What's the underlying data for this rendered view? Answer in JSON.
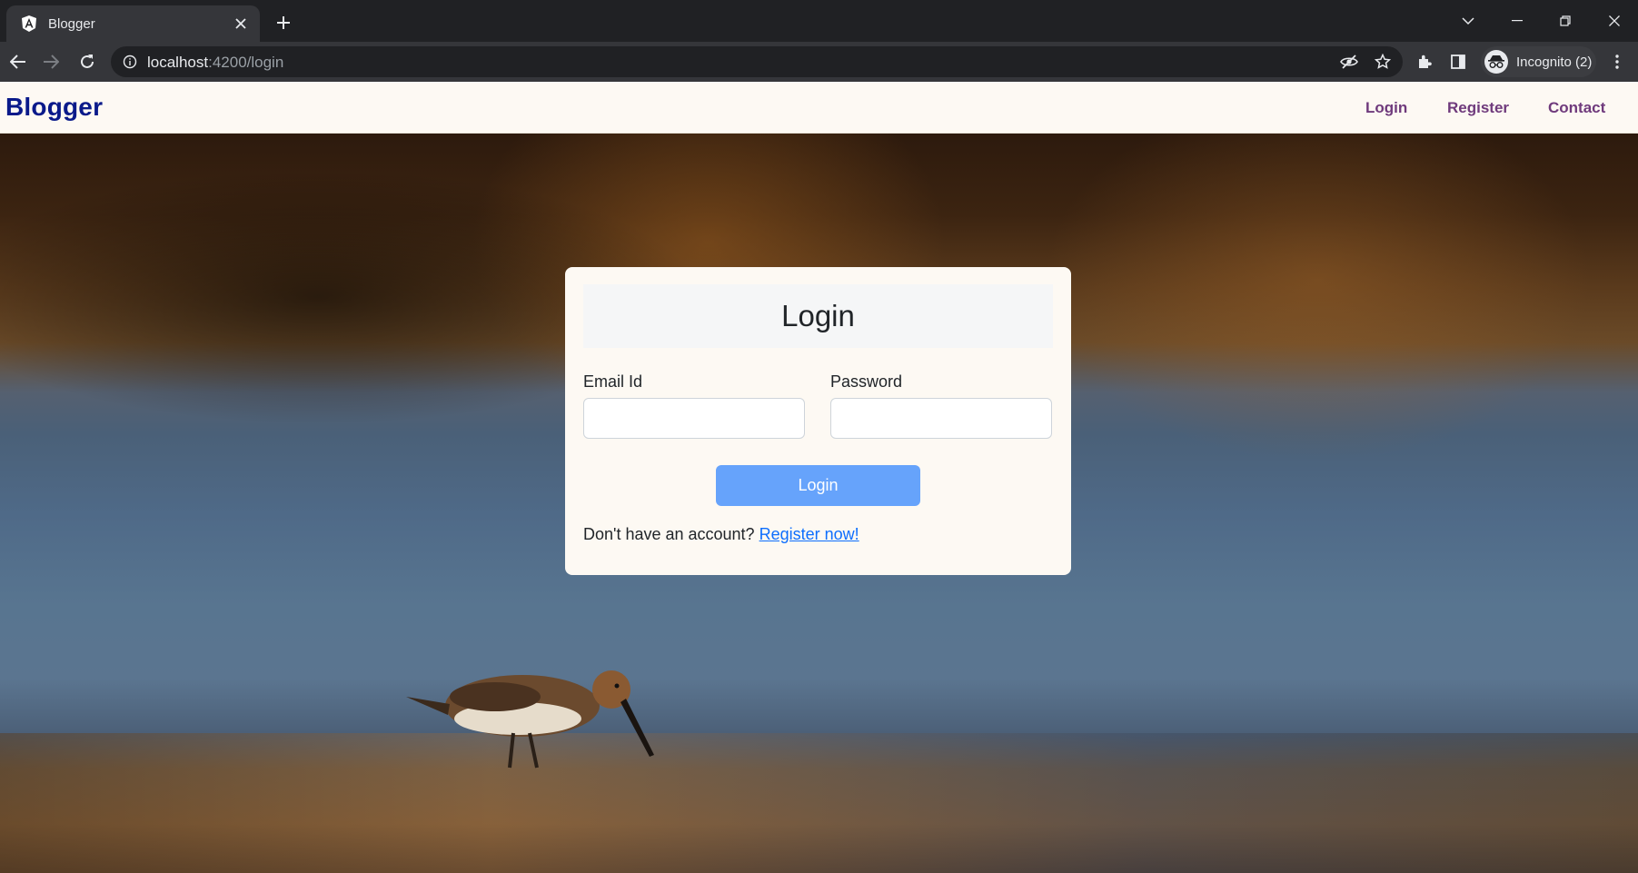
{
  "browser": {
    "tab_title": "Blogger",
    "url_host": "localhost",
    "url_rest": ":4200/login",
    "profile_label": "Incognito (2)"
  },
  "navbar": {
    "brand": "Blogger",
    "links": [
      "Login",
      "Register",
      "Contact"
    ]
  },
  "login_card": {
    "title": "Login",
    "email_label": "Email Id",
    "email_value": "",
    "password_label": "Password",
    "password_value": "",
    "submit_label": "Login",
    "register_prompt": "Don't have an account?",
    "register_link": "Register now!"
  },
  "colors": {
    "brand": "#0a1a8a",
    "nav_link": "#6f3a7c",
    "button": "#66a3fb",
    "link": "#0d6efd"
  }
}
